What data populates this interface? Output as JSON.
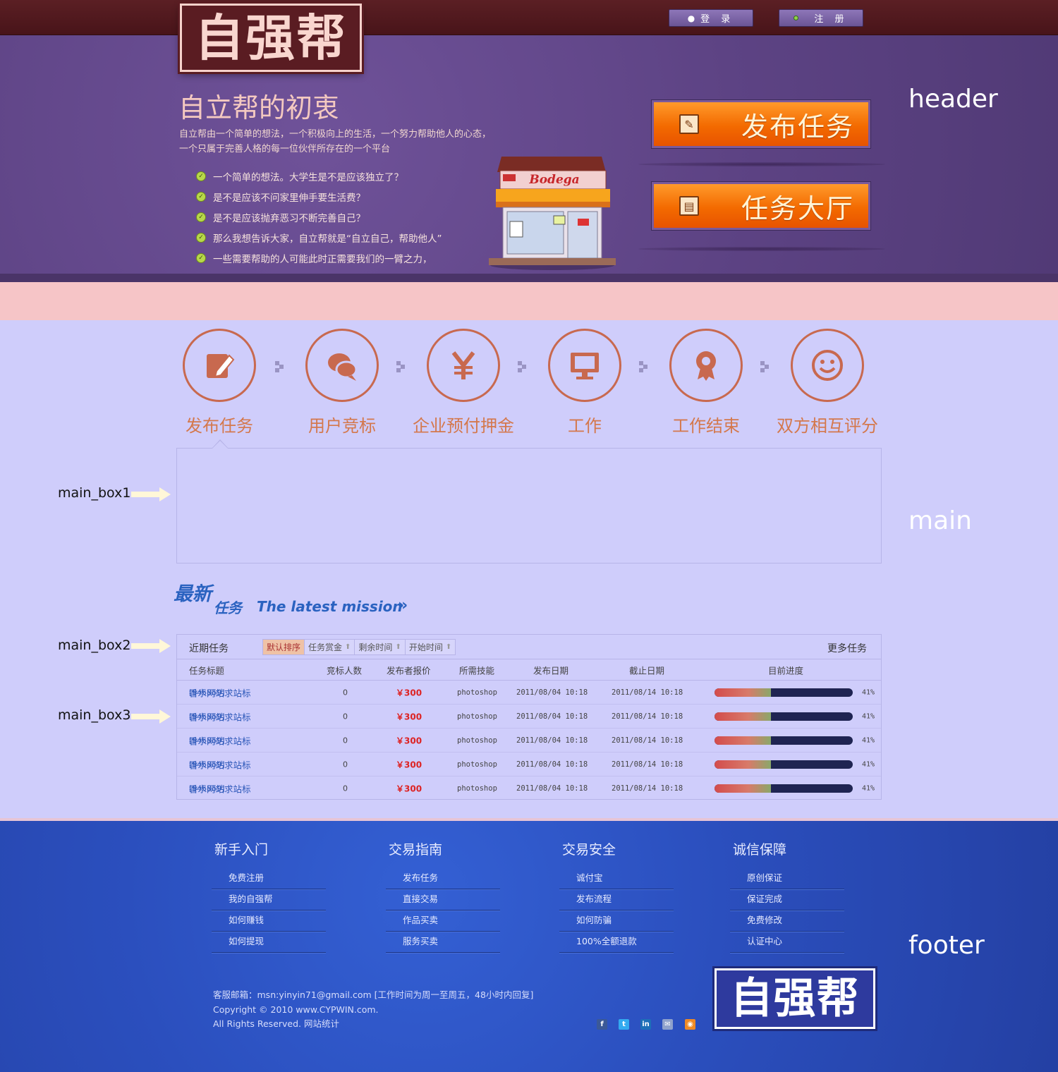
{
  "header": {
    "logo_text": "自强帮",
    "login_label": "登 录",
    "register_label": "注 册",
    "headline": "自立帮的初衷",
    "intro_lines": [
      "自立帮由一个简单的想法，一个积极向上的生活，一个努力帮助他人的心态，",
      "一个只属于完善人格的每一位伙伴所存在的一个平台"
    ],
    "checklist": [
      "一个简单的想法。大学生是不是应该独立了？",
      "是不是应该不问家里伸手要生活费？",
      "是不是应该抛弃恶习不断完善自己？",
      "那么我想告诉大家，自立帮就是“自立自己，帮助他人”",
      "一些需要帮助的人可能此时正需要我们的一臂之力，"
    ],
    "shop_sign": "Bodega",
    "publish_button": "发布任务",
    "hall_button": "任务大厅",
    "annotation": "header"
  },
  "main": {
    "annotation": "main",
    "steps": [
      {
        "label": "发布任务",
        "icon": "edit-icon"
      },
      {
        "label": "用户竞标",
        "icon": "chat-icon"
      },
      {
        "label": "企业预付押金",
        "icon": "yen-icon"
      },
      {
        "label": "工作",
        "icon": "monitor-icon"
      },
      {
        "label": "工作结束",
        "icon": "award-icon"
      },
      {
        "label": "双方相互评分",
        "icon": "smile-icon"
      }
    ],
    "box_labels": [
      "main_box1",
      "main_box2",
      "main_box3"
    ],
    "latest": {
      "cn_part1": "最新",
      "cn_part2": "任务",
      "en": "The latest mission",
      "chevron": "»"
    },
    "tasks": {
      "title": "近期任务",
      "sorts": [
        "默认排序",
        "任务赏金",
        "剩余时间",
        "开始时间"
      ],
      "more": "更多任务",
      "columns": [
        "任务标题",
        "竞标人数",
        "发布者报价",
        "所需技能",
        "发布日期",
        "截止日期",
        "目前进度"
      ],
      "rows": [
        {
          "id": "[945859]",
          "title": "香水网站求站标",
          "bids": "0",
          "price": "￥300",
          "skill": "photoshop",
          "start": "2011/08/04 10:18",
          "end": "2011/08/14 10:18",
          "progress": 0.41,
          "progress_label": "41%"
        },
        {
          "id": "[945859]",
          "title": "香水网站求站标",
          "bids": "0",
          "price": "￥300",
          "skill": "photoshop",
          "start": "2011/08/04 10:18",
          "end": "2011/08/14 10:18",
          "progress": 0.41,
          "progress_label": "41%"
        },
        {
          "id": "[945859]",
          "title": "香水网站求站标",
          "bids": "0",
          "price": "￥300",
          "skill": "photoshop",
          "start": "2011/08/04 10:18",
          "end": "2011/08/14 10:18",
          "progress": 0.41,
          "progress_label": "41%"
        },
        {
          "id": "[945859]",
          "title": "香水网站求站标",
          "bids": "0",
          "price": "￥300",
          "skill": "photoshop",
          "start": "2011/08/04 10:18",
          "end": "2011/08/14 10:18",
          "progress": 0.41,
          "progress_label": "41%"
        },
        {
          "id": "[945859]",
          "title": "香水网站求站标",
          "bids": "0",
          "price": "￥300",
          "skill": "photoshop",
          "start": "2011/08/04 10:18",
          "end": "2011/08/14 10:18",
          "progress": 0.41,
          "progress_label": "41%"
        }
      ]
    }
  },
  "footer": {
    "annotation": "footer",
    "columns": [
      {
        "head": "新手入门",
        "links": [
          "免费注册",
          "我的自强帮",
          "如何赚钱",
          "如何提现"
        ]
      },
      {
        "head": "交易指南",
        "links": [
          "发布任务",
          "直接交易",
          "作品买卖",
          "服务买卖"
        ]
      },
      {
        "head": "交易安全",
        "links": [
          "诚付宝",
          "发布流程",
          "如何防骗",
          "100%全额退款"
        ]
      },
      {
        "head": "诚信保障",
        "links": [
          "原创保证",
          "保证完成",
          "免费修改",
          "认证中心"
        ]
      }
    ],
    "contact": "客服邮箱：msn:yinyin71@gmail.com [工作时间为周一至周五，48小时内回复]",
    "copyright": "Copyright © 2010 www.CYPWIN.com.",
    "rights": "All Rights Reserved. 网站统计",
    "logo_text": "自强帮",
    "social": [
      {
        "name": "facebook-icon",
        "glyph": "f",
        "color": "#3b5998"
      },
      {
        "name": "twitter-icon",
        "glyph": "t",
        "color": "#33aaf0"
      },
      {
        "name": "linkedin-icon",
        "glyph": "in",
        "color": "#1d6fb8"
      },
      {
        "name": "mail-icon",
        "glyph": "✉",
        "color": "#8fa2cc"
      },
      {
        "name": "rss-icon",
        "glyph": "◉",
        "color": "#f08a24"
      }
    ]
  }
}
